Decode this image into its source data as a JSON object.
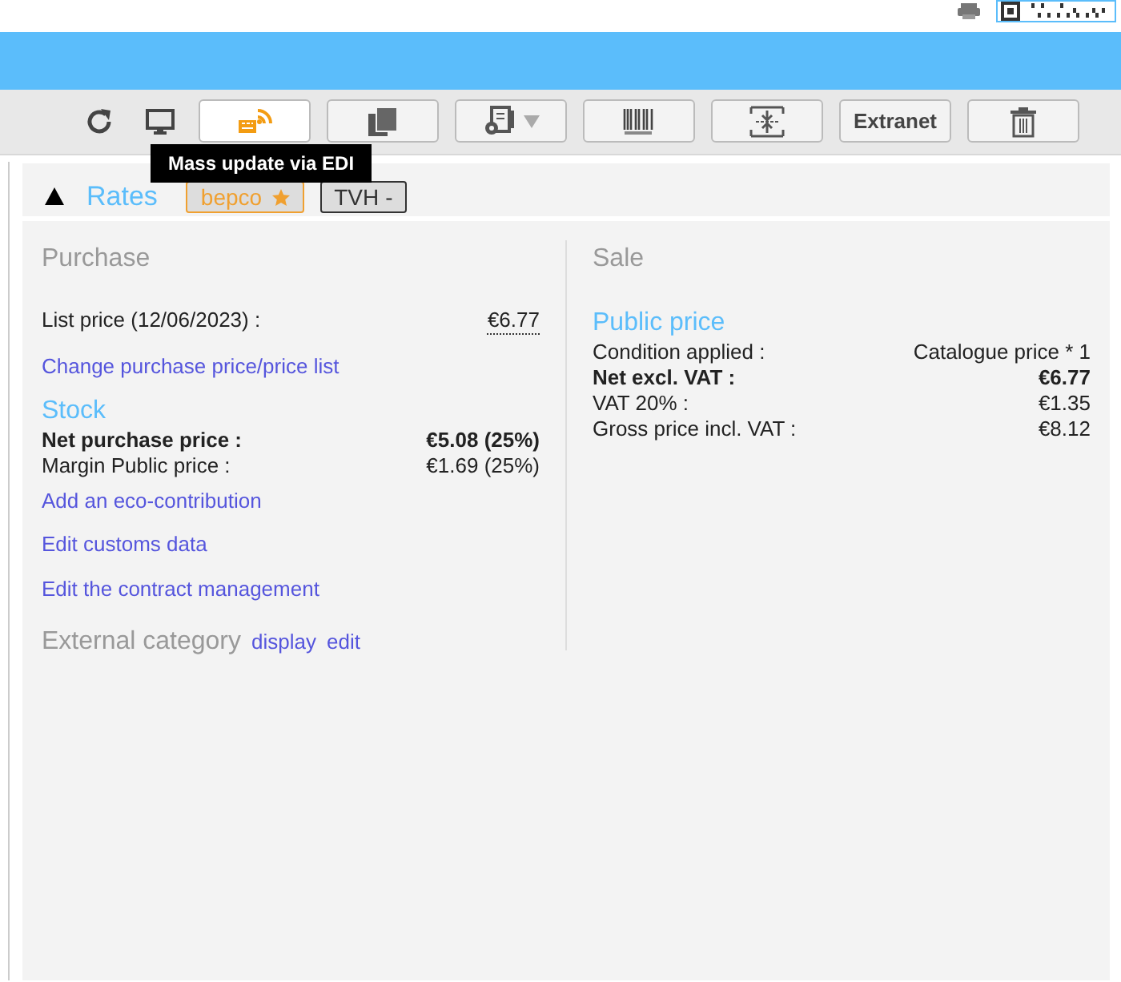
{
  "toolbar": {
    "buttons": [
      {
        "kind": "bare"
      },
      {
        "kind": "bare"
      },
      {
        "kind": "boxed",
        "hovered": true
      },
      {
        "kind": "boxed",
        "hovered": false
      },
      {
        "kind": "boxed",
        "hovered": false,
        "dropdown": true
      },
      {
        "kind": "boxed",
        "hovered": false
      },
      {
        "kind": "boxed",
        "hovered": false
      },
      {
        "kind": "boxed",
        "label": "Extranet",
        "hovered": false
      },
      {
        "kind": "boxed",
        "hovered": false
      }
    ]
  },
  "tooltip": "Mass update via EDI",
  "section": {
    "title": "Rates",
    "expanded": true,
    "tags": [
      {
        "label": "bepco",
        "starred": true,
        "color": "#f0a030"
      },
      {
        "label": "TVH",
        "extra": "-",
        "color": "#333333"
      }
    ],
    "purchase": {
      "heading": "Purchase",
      "items": [
        {
          "kind": "row",
          "label": "List price (12/06/2023) :",
          "value": "€6.77",
          "bold": false,
          "dotted": true
        },
        {
          "kind": "link",
          "text": "Change purchase price/price list"
        },
        {
          "kind": "subheading",
          "text": "Stock"
        },
        {
          "kind": "row",
          "label": "Net purchase price :",
          "value": "€5.08 (25%)",
          "bold": true
        },
        {
          "kind": "row",
          "label": "Margin Public price :",
          "value": "€1.69 (25%)",
          "bold": false
        },
        {
          "kind": "link",
          "text": "Add an eco-contribution"
        },
        {
          "kind": "link",
          "text": "Edit customs data"
        },
        {
          "kind": "link",
          "text": "Edit the contract management"
        },
        {
          "kind": "category",
          "text": "External category",
          "links": [
            "display",
            "edit"
          ]
        }
      ]
    },
    "sale": {
      "heading": "Sale",
      "items": [
        {
          "kind": "subheading",
          "text": "Public price"
        },
        {
          "kind": "row",
          "label": "Condition applied :",
          "value": "Catalogue price * 1",
          "bold": false
        },
        {
          "kind": "row",
          "label": "Net excl. VAT :",
          "value": "€6.77",
          "bold": true
        },
        {
          "kind": "row",
          "label": "VAT 20% :",
          "value": "€1.35",
          "bold": false
        },
        {
          "kind": "row",
          "label": "Gross price incl. VAT :",
          "value": "€8.12",
          "bold": false
        }
      ]
    }
  }
}
